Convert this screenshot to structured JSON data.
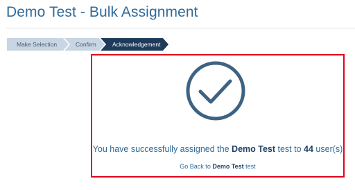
{
  "header": {
    "title": "Demo Test - Bulk Assignment"
  },
  "wizard": {
    "steps": [
      {
        "label": "Make Selection",
        "state": "completed"
      },
      {
        "label": "Confirm",
        "state": "completed"
      },
      {
        "label": "Acknowledgement",
        "state": "active"
      }
    ]
  },
  "result": {
    "icon": "checkmark-circle-icon",
    "message_prefix": "You have successfully assigned the ",
    "test_name": "Demo Test",
    "message_middle": " test to ",
    "user_count": "44",
    "message_suffix": " user(s)",
    "back_prefix": "Go Back to ",
    "back_test_name": "Demo Test",
    "back_suffix": " test"
  },
  "colors": {
    "title": "#2f6a98",
    "step_inactive_bg": "#c8d5e2",
    "step_active_bg": "#1f3b5c",
    "highlight_border": "#e3001b",
    "icon_stroke": "#3e6382"
  }
}
